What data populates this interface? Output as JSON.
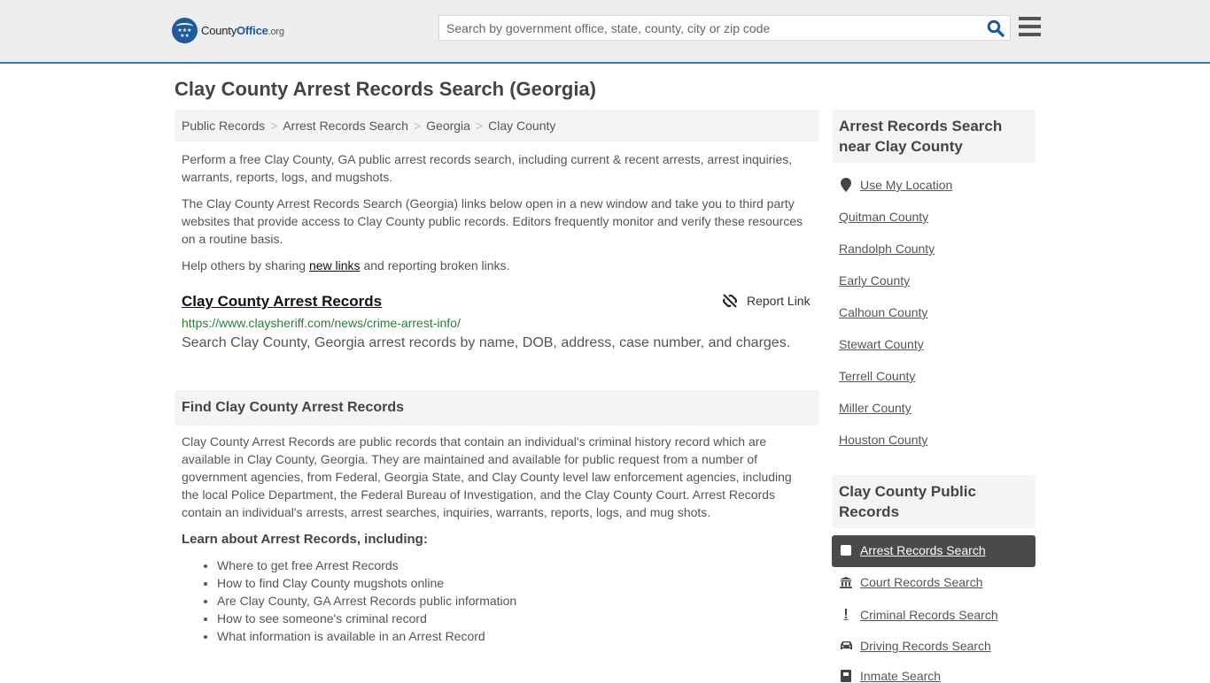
{
  "header": {
    "logo": {
      "name_plain": "County",
      "name_bold": "Office",
      "tld": ".org"
    },
    "search": {
      "placeholder": "Search by government office, state, county, city or zip code",
      "value": ""
    },
    "colors": {
      "brand": "#1f5a9e",
      "header_bg": "#eeeeee",
      "accent_line": "#3a79b8"
    }
  },
  "page": {
    "title": "Clay County Arrest Records Search (Georgia)",
    "breadcrumb": [
      "Public Records",
      "Arrest Records Search",
      "Georgia",
      "Clay County"
    ],
    "intro": [
      "Perform a free Clay County, GA public arrest records search, including current & recent arrests, arrest inquiries, warrants, reports, logs, and mugshots.",
      "The Clay County Arrest Records Search (Georgia) links below open in a new window and take you to third party websites that provide access to Clay County public records. Editors frequently monitor and verify these resources on a routine basis."
    ],
    "help": {
      "before": "Help others by sharing ",
      "link": "new links",
      "after": " and reporting broken links."
    },
    "result": {
      "title": "Clay County Arrest Records",
      "url": "https://www.claysheriff.com/news/crime-arrest-info/",
      "description": "Search Clay County, Georgia arrest records by name, DOB, address, case number, and charges.",
      "report_label": "Report Link"
    },
    "find_section": {
      "heading": "Find Clay County Arrest Records",
      "body": "Clay County Arrest Records are public records that contain an individual's criminal history record which are available in Clay County, Georgia. They are maintained and available for public request from a number of government agencies, from Federal, Georgia State, and Clay County level law enforcement agencies, including the local Police Department, the Federal Bureau of Investigation, and the Clay County Court. Arrest Records contain an individual's arrests, arrest searches, inquiries, warrants, reports, logs, and mug shots.",
      "learn_heading": "Learn about Arrest Records, including:",
      "learn_items": [
        "Where to get free Arrest Records",
        "How to find Clay County mugshots online",
        "Are Clay County, GA Arrest Records public information",
        "How to see someone's criminal record",
        "What information is available in an Arrest Record"
      ]
    }
  },
  "sidebar": {
    "nearby": {
      "heading": "Arrest Records Search near Clay County",
      "use_location": "Use My Location",
      "counties": [
        "Quitman County",
        "Randolph County",
        "Early County",
        "Calhoun County",
        "Stewart County",
        "Terrell County",
        "Miller County",
        "Houston County"
      ]
    },
    "public_records": {
      "heading": "Clay County Public Records",
      "items": [
        {
          "label": "Arrest Records Search",
          "icon": "square-icon",
          "active": true
        },
        {
          "label": "Court Records Search",
          "icon": "courthouse-icon",
          "active": false
        },
        {
          "label": "Criminal Records Search",
          "icon": "exclamation-icon",
          "active": false
        },
        {
          "label": "Driving Records Search",
          "icon": "car-icon",
          "active": false
        },
        {
          "label": "Inmate Search",
          "icon": "id-card-icon",
          "active": false
        }
      ]
    }
  }
}
